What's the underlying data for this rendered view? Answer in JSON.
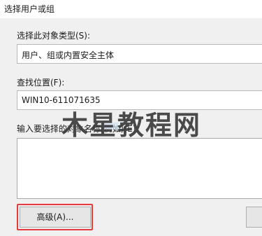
{
  "window": {
    "title": "选择用户或组"
  },
  "object_type": {
    "label": "选择此对象类型(S):",
    "value": "用户、组或内置安全主体"
  },
  "location": {
    "label": "查找位置(F):",
    "value": "WIN10-611071635"
  },
  "names": {
    "label": "输入要选择的对象名称(例如)(E):",
    "value": ""
  },
  "buttons": {
    "advanced": "高级(A)..."
  },
  "watermark": {
    "text": "木星教程网"
  },
  "colors": {
    "highlight": "#e53b3b",
    "background": "#f0f0f0"
  }
}
